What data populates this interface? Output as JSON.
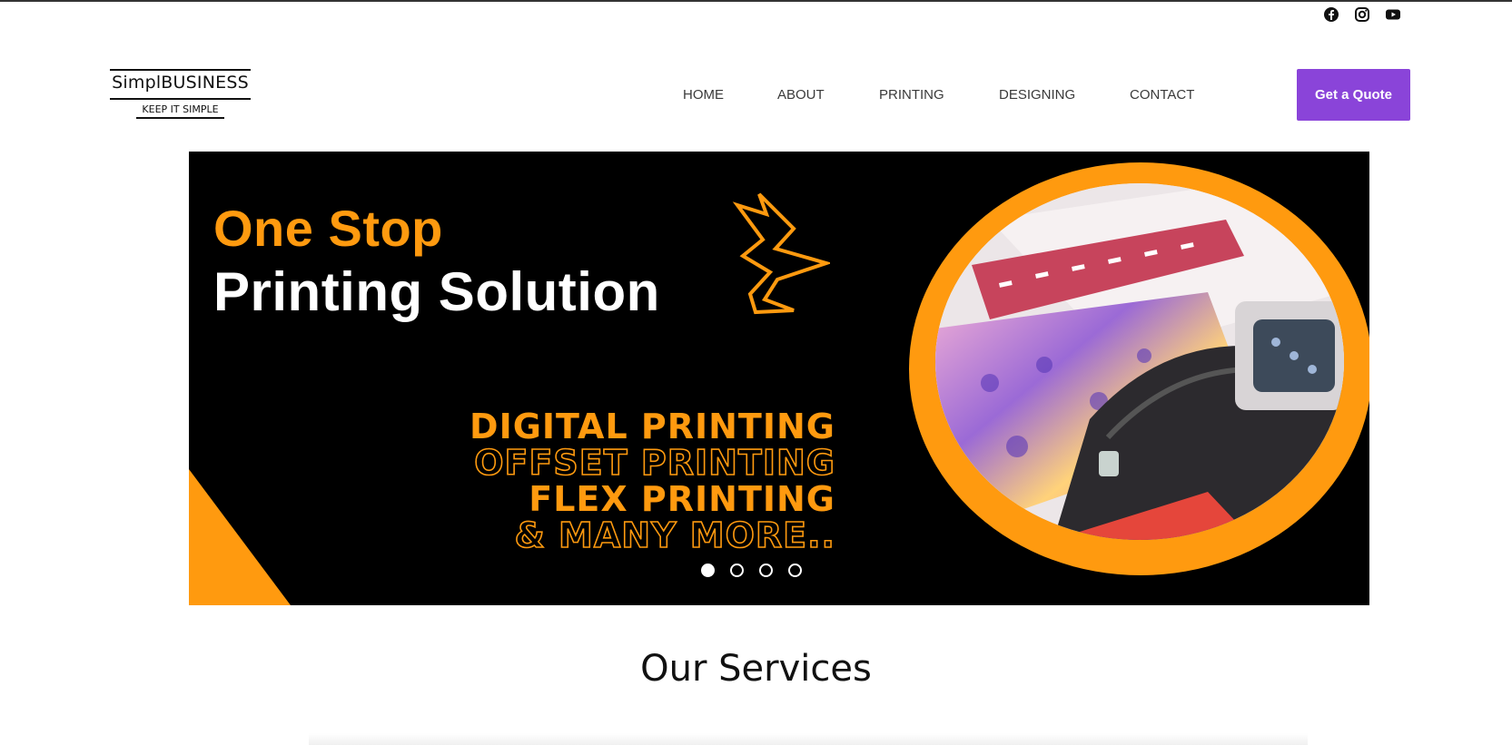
{
  "brand": {
    "name": "SimplBUSINESS",
    "tagline": "KEEP IT SIMPLE"
  },
  "social": [
    "facebook-icon",
    "instagram-icon",
    "youtube-icon"
  ],
  "nav": {
    "items": [
      {
        "label": "HOME"
      },
      {
        "label": "ABOUT"
      },
      {
        "label": "PRINTING"
      },
      {
        "label": "DESIGNING"
      },
      {
        "label": "CONTACT"
      }
    ]
  },
  "cta": {
    "label": "Get a Quote"
  },
  "banner": {
    "headline_line1": "One Stop",
    "headline_line2": "Printing Solution",
    "services": [
      "DIGITAL PRINTING",
      "OFFSET PRINTING",
      "FLEX PRINTING",
      "& MANY MORE.."
    ],
    "slides_total": 4,
    "active_slide": 1
  },
  "section": {
    "title": "Our Services"
  },
  "colors": {
    "accent_orange": "#ff9a0f",
    "button_purple": "#8a44d9",
    "banner_bg": "#000000"
  }
}
